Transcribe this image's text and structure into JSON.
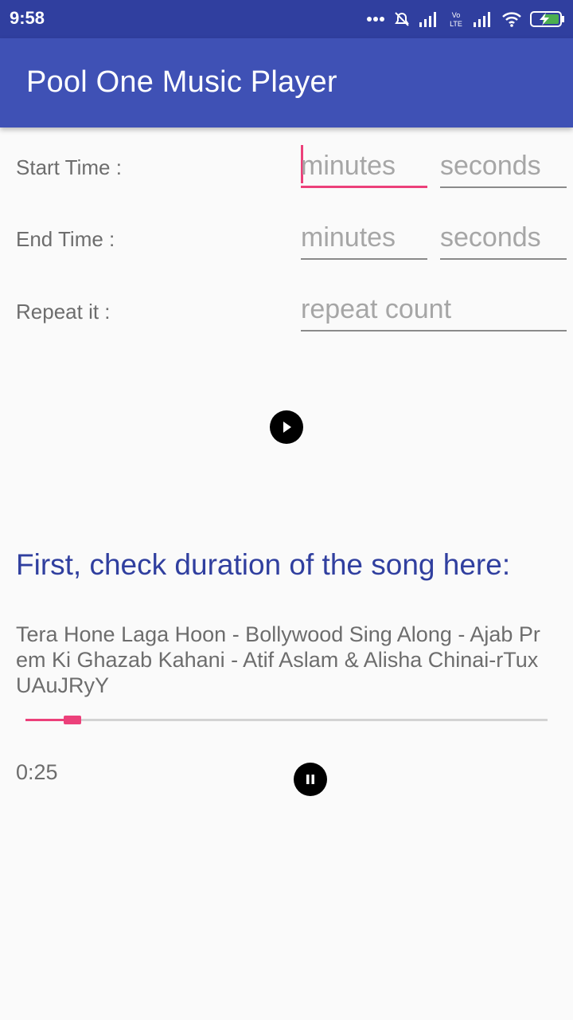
{
  "status_bar": {
    "time": "9:58",
    "network_label": "Vo)) LTE",
    "battery_color": "#4caf50"
  },
  "app_bar": {
    "title": "Pool One Music Player",
    "color": "#3f51b5"
  },
  "form": {
    "start_time": {
      "label": "Start Time :",
      "minutes_placeholder": "minutes",
      "seconds_placeholder": "seconds"
    },
    "end_time": {
      "label": "End Time :",
      "minutes_placeholder": "minutes",
      "seconds_placeholder": "seconds"
    },
    "repeat": {
      "label": "Repeat it :",
      "placeholder": "repeat count"
    },
    "play_icon": "play-icon"
  },
  "player": {
    "heading": "First, check duration of the song here:",
    "song_title": "Tera Hone Laga Hoon - Bollywood Sing Along - Ajab Prem Ki Ghazab Kahani - Atif Aslam & Alisha Chinai-rTuxUAuJRyY",
    "progress_fraction": 0.09,
    "elapsed_time": "0:25",
    "pause_icon": "pause-icon",
    "accent_color": "#ec407a"
  }
}
